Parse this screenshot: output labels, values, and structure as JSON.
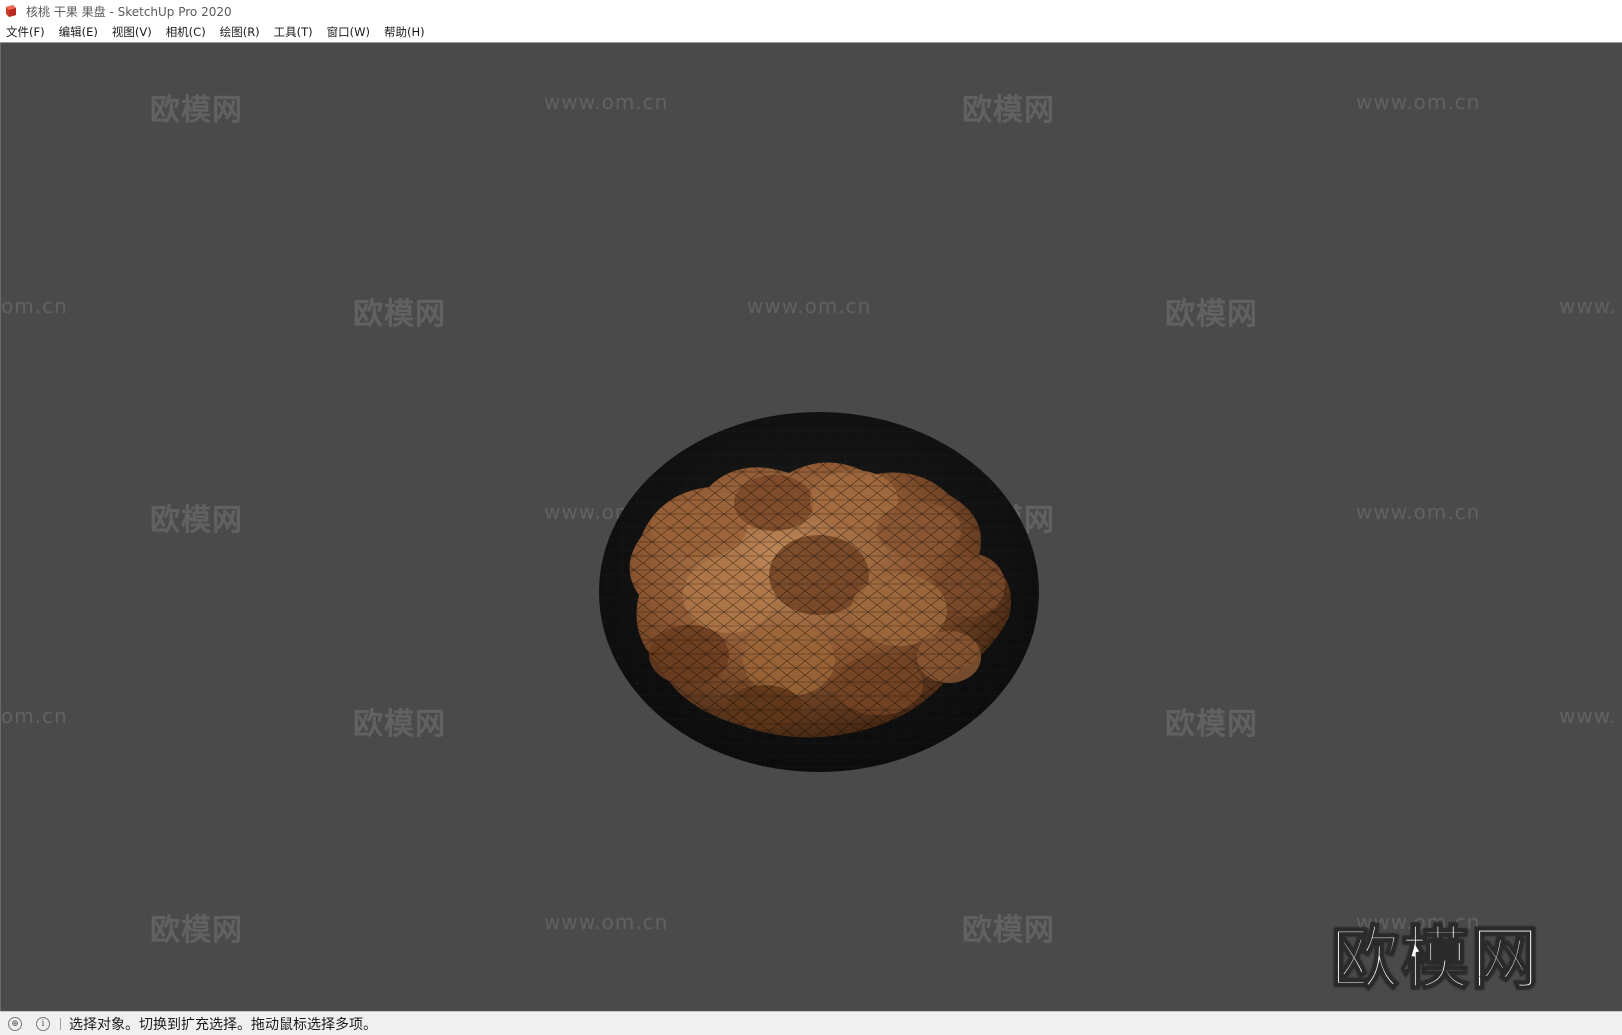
{
  "window": {
    "title": "核桃 干果 果盘 - SketchUp Pro 2020"
  },
  "menu": {
    "items": [
      "文件(F)",
      "编辑(E)",
      "视图(V)",
      "相机(C)",
      "绘图(R)",
      "工具(T)",
      "窗口(W)",
      "帮助(H)"
    ]
  },
  "watermarks": {
    "cn": "欧模网",
    "url": "www.om.cn",
    "url_partial_left": "om.cn",
    "url_partial_right": "www.",
    "big_logo": "欧模网"
  },
  "viewport": {
    "background": "#4a4a4a"
  },
  "status": {
    "geo_icon": "geo-location-icon",
    "info_icon": "info-icon",
    "text": "选择对象。切换到扩充选择。拖动鼠标选择多项。"
  }
}
